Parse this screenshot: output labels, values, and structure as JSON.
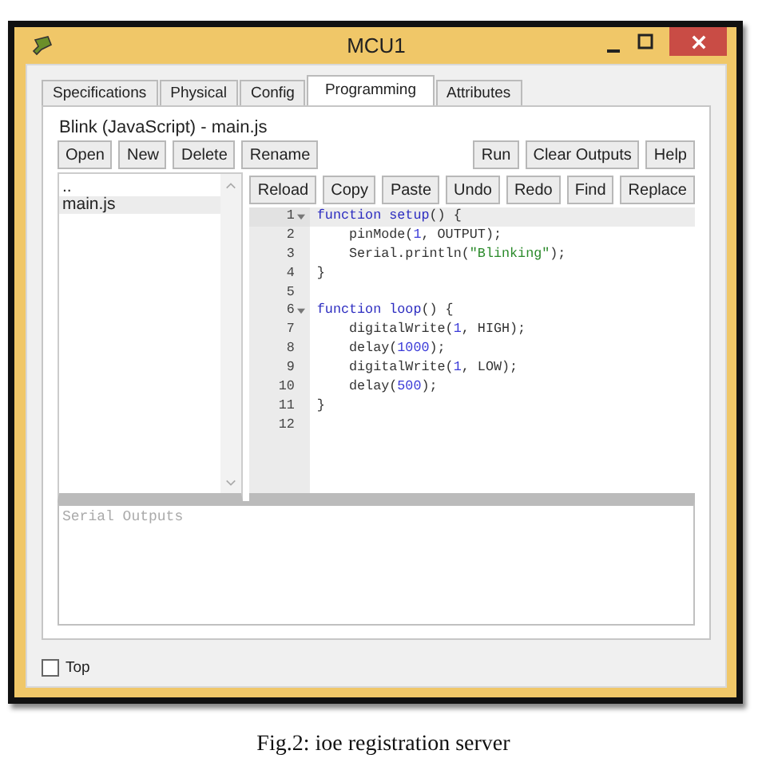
{
  "window": {
    "title": "MCU1"
  },
  "tabs": [
    {
      "label": "Specifications",
      "selected": false
    },
    {
      "label": "Physical",
      "selected": false
    },
    {
      "label": "Config",
      "selected": false
    },
    {
      "label": "Programming",
      "selected": true
    },
    {
      "label": "Attributes",
      "selected": false
    }
  ],
  "project_title": "Blink (JavaScript) - main.js",
  "file_buttons": [
    "Open",
    "New",
    "Delete",
    "Rename"
  ],
  "run_buttons": [
    "Run",
    "Clear Outputs",
    "Help"
  ],
  "files": [
    {
      "name": "..",
      "selected": false
    },
    {
      "name": "main.js",
      "selected": true
    }
  ],
  "editor_buttons": [
    "Reload",
    "Copy",
    "Paste",
    "Undo",
    "Redo",
    "Find",
    "Replace"
  ],
  "code_lines": [
    {
      "number": "1",
      "active": true,
      "foldable": true,
      "tokens": [
        {
          "kind": "keyword",
          "text": "function setup"
        },
        {
          "kind": "plain",
          "text": "() {"
        }
      ]
    },
    {
      "number": "2",
      "active": false,
      "foldable": false,
      "tokens": [
        {
          "kind": "plain",
          "text": "    pinMode("
        },
        {
          "kind": "number",
          "text": "1"
        },
        {
          "kind": "plain",
          "text": ", OUTPUT);"
        }
      ]
    },
    {
      "number": "3",
      "active": false,
      "foldable": false,
      "tokens": [
        {
          "kind": "plain",
          "text": "    Serial.println("
        },
        {
          "kind": "string",
          "text": "\"Blinking\""
        },
        {
          "kind": "plain",
          "text": ");"
        }
      ]
    },
    {
      "number": "4",
      "active": false,
      "foldable": false,
      "tokens": [
        {
          "kind": "plain",
          "text": "}"
        }
      ]
    },
    {
      "number": "5",
      "active": false,
      "foldable": false
    },
    {
      "number": "6",
      "active": false,
      "foldable": true,
      "tokens": [
        {
          "kind": "keyword",
          "text": "function loop"
        },
        {
          "kind": "plain",
          "text": "() {"
        }
      ]
    },
    {
      "number": "7",
      "active": false,
      "foldable": false,
      "tokens": [
        {
          "kind": "plain",
          "text": "    digitalWrite("
        },
        {
          "kind": "number",
          "text": "1"
        },
        {
          "kind": "plain",
          "text": ", HIGH);"
        }
      ]
    },
    {
      "number": "8",
      "active": false,
      "foldable": false,
      "tokens": [
        {
          "kind": "plain",
          "text": "    delay("
        },
        {
          "kind": "number",
          "text": "1000"
        },
        {
          "kind": "plain",
          "text": ");"
        }
      ]
    },
    {
      "number": "9",
      "active": false,
      "foldable": false,
      "tokens": [
        {
          "kind": "plain",
          "text": "    digitalWrite("
        },
        {
          "kind": "number",
          "text": "1"
        },
        {
          "kind": "plain",
          "text": ", LOW);"
        }
      ]
    },
    {
      "number": "10",
      "active": false,
      "foldable": false,
      "tokens": [
        {
          "kind": "plain",
          "text": "    delay("
        },
        {
          "kind": "number",
          "text": "500"
        },
        {
          "kind": "plain",
          "text": ");"
        }
      ]
    },
    {
      "number": "11",
      "active": false,
      "foldable": false,
      "tokens": [
        {
          "kind": "plain",
          "text": "}"
        }
      ]
    },
    {
      "number": "12",
      "active": false,
      "foldable": false
    }
  ],
  "serial_output": {
    "placeholder": "Serial Outputs"
  },
  "top_checkbox": {
    "label": "Top",
    "checked": false
  },
  "caption": "Fig.2: ioe registration server"
}
